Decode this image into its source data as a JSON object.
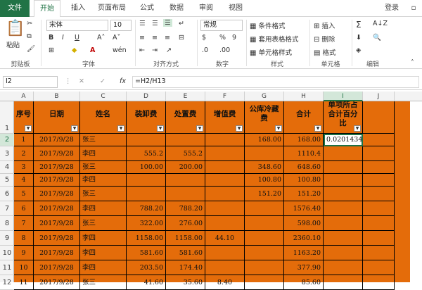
{
  "tabs": {
    "file": "文件",
    "home": "开始",
    "insert": "插入",
    "layout": "页面布局",
    "formulas": "公式",
    "data": "数据",
    "review": "审阅",
    "view": "视图",
    "login": "登录"
  },
  "ribbon": {
    "paste": "粘贴",
    "font_name": "宋体",
    "font_size": "10",
    "number_format": "常规",
    "percent": "%",
    "comma": "9",
    "cond_format": "条件格式",
    "table_format": "套用表格格式",
    "cell_style": "单元格样式",
    "insert": "插入",
    "delete": "删除",
    "format": "格式",
    "groups": {
      "clipboard": "剪贴板",
      "font": "字体",
      "align": "对齐方式",
      "number": "数字",
      "styles": "样式",
      "cells": "单元格",
      "edit": "编辑"
    }
  },
  "formula_bar": {
    "name_box": "I2",
    "fx": "fx",
    "formula": "=H2/H13"
  },
  "columns": [
    "A",
    "B",
    "C",
    "D",
    "E",
    "F",
    "G",
    "H",
    "I",
    "J"
  ],
  "rows": [
    "1",
    "2",
    "3",
    "4",
    "5",
    "6",
    "7",
    "8",
    "9",
    "10",
    "11",
    "12"
  ],
  "headers": [
    "序号",
    "日期",
    "姓名",
    "装卸费",
    "处置费",
    "增值费",
    "公库冷藏费",
    "合计",
    "单项所占合计百分比"
  ],
  "table": [
    [
      "1",
      "2017/9/28",
      "张三",
      "",
      "",
      "",
      "168.00",
      "168.00",
      "0.0201434"
    ],
    [
      "2",
      "2017/9/28",
      "李四",
      "555.2",
      "555.2",
      "",
      "",
      "1110.4",
      ""
    ],
    [
      "3",
      "2017/9/28",
      "张三",
      "100.00",
      "200.00",
      "",
      "348.60",
      "648.60",
      ""
    ],
    [
      "4",
      "2017/9/28",
      "李四",
      "",
      "",
      "",
      "100.80",
      "100.80",
      ""
    ],
    [
      "5",
      "2017/9/28",
      "张三",
      "",
      "",
      "",
      "151.20",
      "151.20",
      ""
    ],
    [
      "6",
      "2017/9/28",
      "李四",
      "788.20",
      "788.20",
      "",
      "",
      "1576.40",
      ""
    ],
    [
      "7",
      "2017/9/28",
      "张三",
      "322.00",
      "276.00",
      "",
      "",
      "598.00",
      ""
    ],
    [
      "8",
      "2017/9/28",
      "李四",
      "1158.00",
      "1158.00",
      "44.10",
      "",
      "2360.10",
      ""
    ],
    [
      "9",
      "2017/9/28",
      "李四",
      "581.60",
      "581.60",
      "",
      "",
      "1163.20",
      ""
    ],
    [
      "10",
      "2017/9/28",
      "李四",
      "203.50",
      "174.40",
      "",
      "",
      "377.90",
      ""
    ],
    [
      "11",
      "2017/9/28",
      "张三",
      "41.60",
      "35.60",
      "8.40",
      "",
      "85.60",
      ""
    ]
  ],
  "colors": {
    "fill": "#e46c0a",
    "accent": "#217346"
  }
}
